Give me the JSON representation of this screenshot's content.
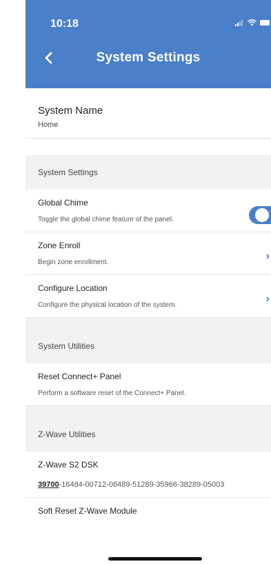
{
  "status_bar": {
    "time": "10:18"
  },
  "header": {
    "title": "System Settings"
  },
  "system_name": {
    "label": "System Name",
    "value": "Home"
  },
  "sections": {
    "system_settings": "System Settings",
    "system_utilities": "System Utilities",
    "zwave_utilities": "Z-Wave Utilities"
  },
  "rows": {
    "global_chime": {
      "title": "Global Chime",
      "desc": "Toggle the global chime feature of the panel.",
      "enabled": true
    },
    "zone_enroll": {
      "title": "Zone Enroll",
      "desc": "Begin zone enrollment."
    },
    "configure_location": {
      "title": "Configure Location",
      "desc": "Configure the physical location of the system."
    },
    "reset_panel": {
      "title": "Reset Connect+ Panel",
      "desc": "Perform a software reset of the Connect+ Panel."
    },
    "zwave_dsk": {
      "title": "Z-Wave S2 DSK",
      "code": "39700",
      "rest": "-16484-00712-06489-51289-35966-38289-05003"
    },
    "soft_reset": {
      "title": "Soft Reset Z-Wave Module"
    }
  },
  "colors": {
    "accent": "#4a7fc9",
    "section_bg": "#f2f2f4"
  }
}
